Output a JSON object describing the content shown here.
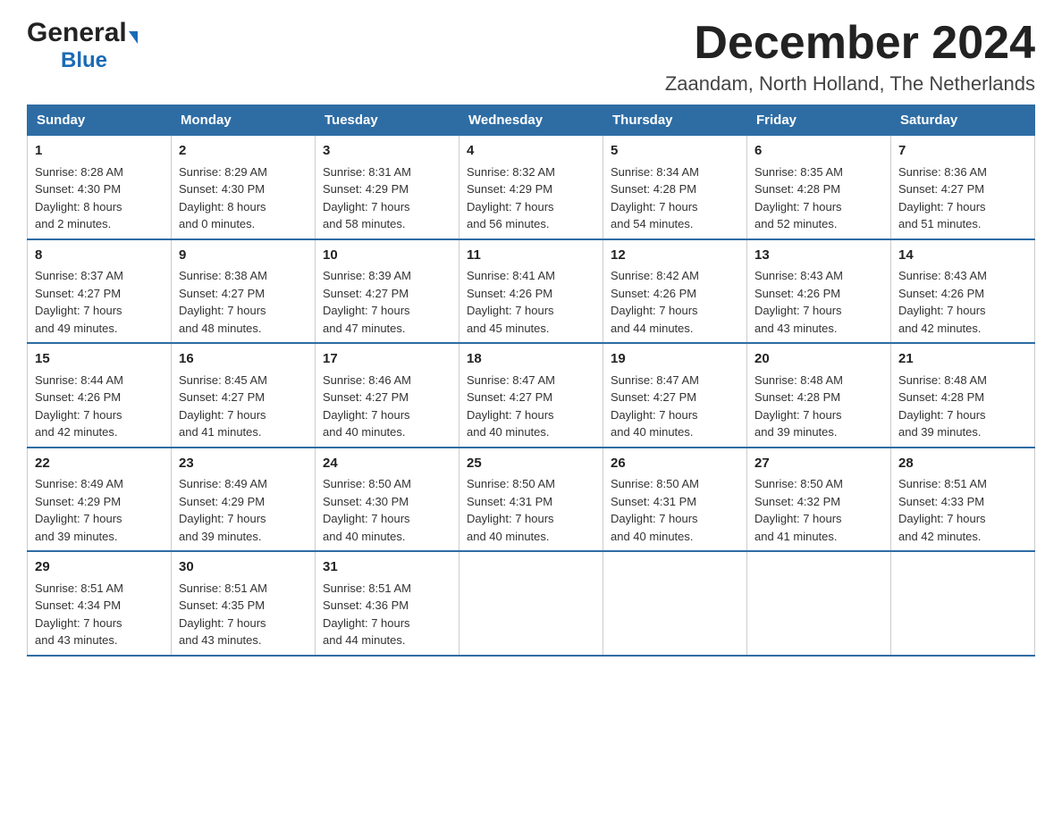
{
  "header": {
    "logo_general": "General",
    "logo_blue": "Blue",
    "month_year": "December 2024",
    "location": "Zaandam, North Holland, The Netherlands"
  },
  "weekdays": [
    "Sunday",
    "Monday",
    "Tuesday",
    "Wednesday",
    "Thursday",
    "Friday",
    "Saturday"
  ],
  "weeks": [
    [
      {
        "day": "1",
        "sunrise": "8:28 AM",
        "sunset": "4:30 PM",
        "daylight": "8 hours and 2 minutes."
      },
      {
        "day": "2",
        "sunrise": "8:29 AM",
        "sunset": "4:30 PM",
        "daylight": "8 hours and 0 minutes."
      },
      {
        "day": "3",
        "sunrise": "8:31 AM",
        "sunset": "4:29 PM",
        "daylight": "7 hours and 58 minutes."
      },
      {
        "day": "4",
        "sunrise": "8:32 AM",
        "sunset": "4:29 PM",
        "daylight": "7 hours and 56 minutes."
      },
      {
        "day": "5",
        "sunrise": "8:34 AM",
        "sunset": "4:28 PM",
        "daylight": "7 hours and 54 minutes."
      },
      {
        "day": "6",
        "sunrise": "8:35 AM",
        "sunset": "4:28 PM",
        "daylight": "7 hours and 52 minutes."
      },
      {
        "day": "7",
        "sunrise": "8:36 AM",
        "sunset": "4:27 PM",
        "daylight": "7 hours and 51 minutes."
      }
    ],
    [
      {
        "day": "8",
        "sunrise": "8:37 AM",
        "sunset": "4:27 PM",
        "daylight": "7 hours and 49 minutes."
      },
      {
        "day": "9",
        "sunrise": "8:38 AM",
        "sunset": "4:27 PM",
        "daylight": "7 hours and 48 minutes."
      },
      {
        "day": "10",
        "sunrise": "8:39 AM",
        "sunset": "4:27 PM",
        "daylight": "7 hours and 47 minutes."
      },
      {
        "day": "11",
        "sunrise": "8:41 AM",
        "sunset": "4:26 PM",
        "daylight": "7 hours and 45 minutes."
      },
      {
        "day": "12",
        "sunrise": "8:42 AM",
        "sunset": "4:26 PM",
        "daylight": "7 hours and 44 minutes."
      },
      {
        "day": "13",
        "sunrise": "8:43 AM",
        "sunset": "4:26 PM",
        "daylight": "7 hours and 43 minutes."
      },
      {
        "day": "14",
        "sunrise": "8:43 AM",
        "sunset": "4:26 PM",
        "daylight": "7 hours and 42 minutes."
      }
    ],
    [
      {
        "day": "15",
        "sunrise": "8:44 AM",
        "sunset": "4:26 PM",
        "daylight": "7 hours and 42 minutes."
      },
      {
        "day": "16",
        "sunrise": "8:45 AM",
        "sunset": "4:27 PM",
        "daylight": "7 hours and 41 minutes."
      },
      {
        "day": "17",
        "sunrise": "8:46 AM",
        "sunset": "4:27 PM",
        "daylight": "7 hours and 40 minutes."
      },
      {
        "day": "18",
        "sunrise": "8:47 AM",
        "sunset": "4:27 PM",
        "daylight": "7 hours and 40 minutes."
      },
      {
        "day": "19",
        "sunrise": "8:47 AM",
        "sunset": "4:27 PM",
        "daylight": "7 hours and 40 minutes."
      },
      {
        "day": "20",
        "sunrise": "8:48 AM",
        "sunset": "4:28 PM",
        "daylight": "7 hours and 39 minutes."
      },
      {
        "day": "21",
        "sunrise": "8:48 AM",
        "sunset": "4:28 PM",
        "daylight": "7 hours and 39 minutes."
      }
    ],
    [
      {
        "day": "22",
        "sunrise": "8:49 AM",
        "sunset": "4:29 PM",
        "daylight": "7 hours and 39 minutes."
      },
      {
        "day": "23",
        "sunrise": "8:49 AM",
        "sunset": "4:29 PM",
        "daylight": "7 hours and 39 minutes."
      },
      {
        "day": "24",
        "sunrise": "8:50 AM",
        "sunset": "4:30 PM",
        "daylight": "7 hours and 40 minutes."
      },
      {
        "day": "25",
        "sunrise": "8:50 AM",
        "sunset": "4:31 PM",
        "daylight": "7 hours and 40 minutes."
      },
      {
        "day": "26",
        "sunrise": "8:50 AM",
        "sunset": "4:31 PM",
        "daylight": "7 hours and 40 minutes."
      },
      {
        "day": "27",
        "sunrise": "8:50 AM",
        "sunset": "4:32 PM",
        "daylight": "7 hours and 41 minutes."
      },
      {
        "day": "28",
        "sunrise": "8:51 AM",
        "sunset": "4:33 PM",
        "daylight": "7 hours and 42 minutes."
      }
    ],
    [
      {
        "day": "29",
        "sunrise": "8:51 AM",
        "sunset": "4:34 PM",
        "daylight": "7 hours and 43 minutes."
      },
      {
        "day": "30",
        "sunrise": "8:51 AM",
        "sunset": "4:35 PM",
        "daylight": "7 hours and 43 minutes."
      },
      {
        "day": "31",
        "sunrise": "8:51 AM",
        "sunset": "4:36 PM",
        "daylight": "7 hours and 44 minutes."
      },
      null,
      null,
      null,
      null
    ]
  ]
}
